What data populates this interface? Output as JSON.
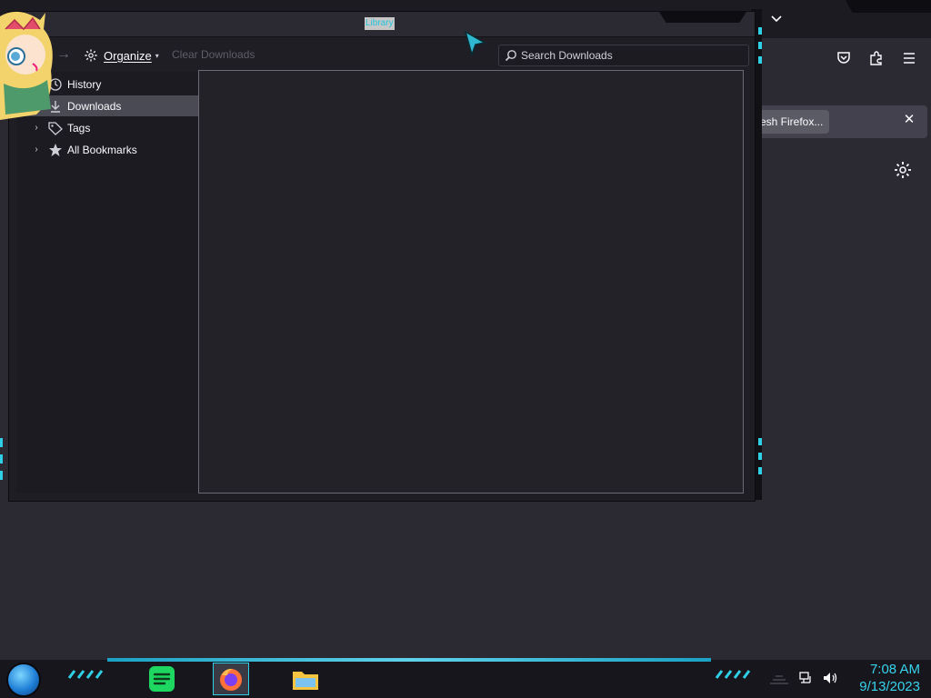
{
  "library_window": {
    "title": "Library",
    "toolbar": {
      "organize_label": "Organize",
      "clear_downloads_label": "Clear Downloads",
      "search_placeholder": "Search Downloads"
    },
    "sidebar": {
      "items": [
        {
          "label": "History",
          "icon": "history-icon",
          "selected": false
        },
        {
          "label": "Downloads",
          "icon": "download-icon",
          "selected": true
        },
        {
          "label": "Tags",
          "icon": "tag-icon",
          "selected": false
        },
        {
          "label": "All Bookmarks",
          "icon": "star-icon",
          "selected": false
        }
      ]
    }
  },
  "browser": {
    "notification": {
      "button_label": "resh Firefox..."
    }
  },
  "taskbar": {
    "apps": [
      "spotify-icon",
      "firefox-icon",
      "file-explorer-icon"
    ],
    "clock": {
      "time": "7:08 AM",
      "date": "9/13/2023"
    }
  },
  "colors": {
    "accent": "#2fd0e6",
    "background": "#2b2a33",
    "clock": "#37d3ec"
  }
}
